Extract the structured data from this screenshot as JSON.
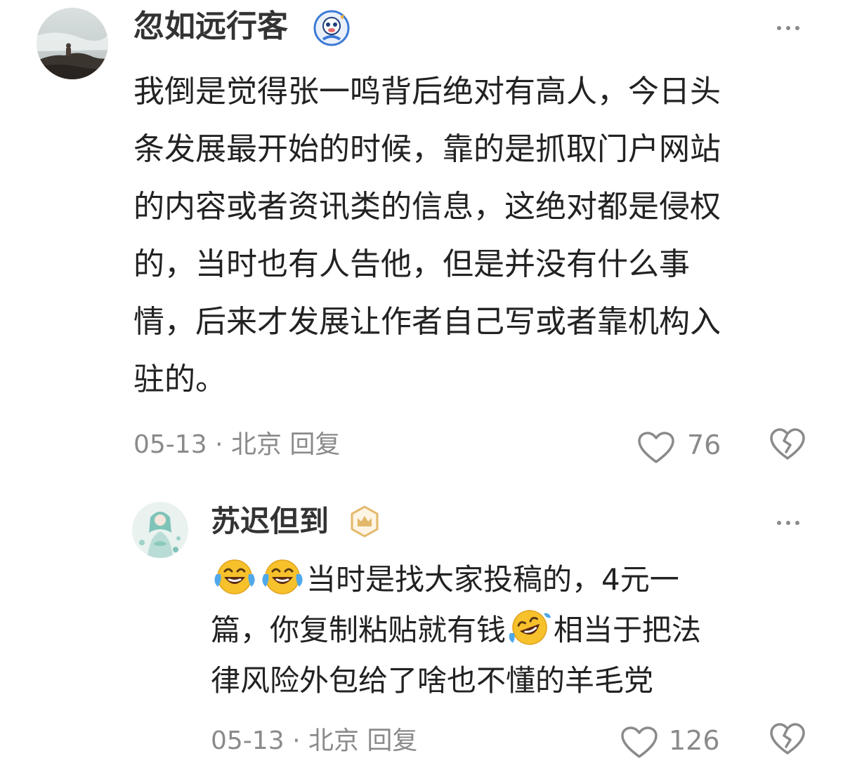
{
  "colors": {
    "text": "#222222",
    "username": "#333333",
    "meta": "#8a8a8a",
    "emoji_yellow": "#f7c12c",
    "badge_gold": "#e3b86a",
    "badge_blue": "#3d7ad6"
  },
  "comments": [
    {
      "username": "忽如远行客",
      "badge_icon": "cartoon-mascot-badge-icon",
      "text_lines": [
        "我倒是觉得张一鸣背后绝对有高人，今日头",
        "条发展最开始的时候，靠的是抓取门户网站",
        "的内容或者资讯类的信息，这绝对都是侵权",
        "的，当时也有人告他，但是并没有什么事",
        "情，后来才发展让作者自己写或者靠机构入",
        "驻的。"
      ],
      "date": "05-13",
      "location": "北京",
      "reply_label": "回复",
      "likes": "76"
    },
    {
      "username": "苏迟但到",
      "badge_icon": "gold-crown-badge-icon",
      "text_line1_emojis": [
        "laughing-crying-emoji",
        "laughing-crying-emoji"
      ],
      "text_line1": "当时是找大家投稿的，4元一",
      "text_line2_before": "篇，你复制粘贴就有钱",
      "text_line2_emoji": "rolling-on-floor-laughing-emoji",
      "text_line2_after": "相当于把法",
      "text_line3": "律风险外包给了啥也不懂的羊毛党",
      "date": "05-13",
      "location": "北京",
      "reply_label": "回复",
      "likes": "126"
    }
  ]
}
